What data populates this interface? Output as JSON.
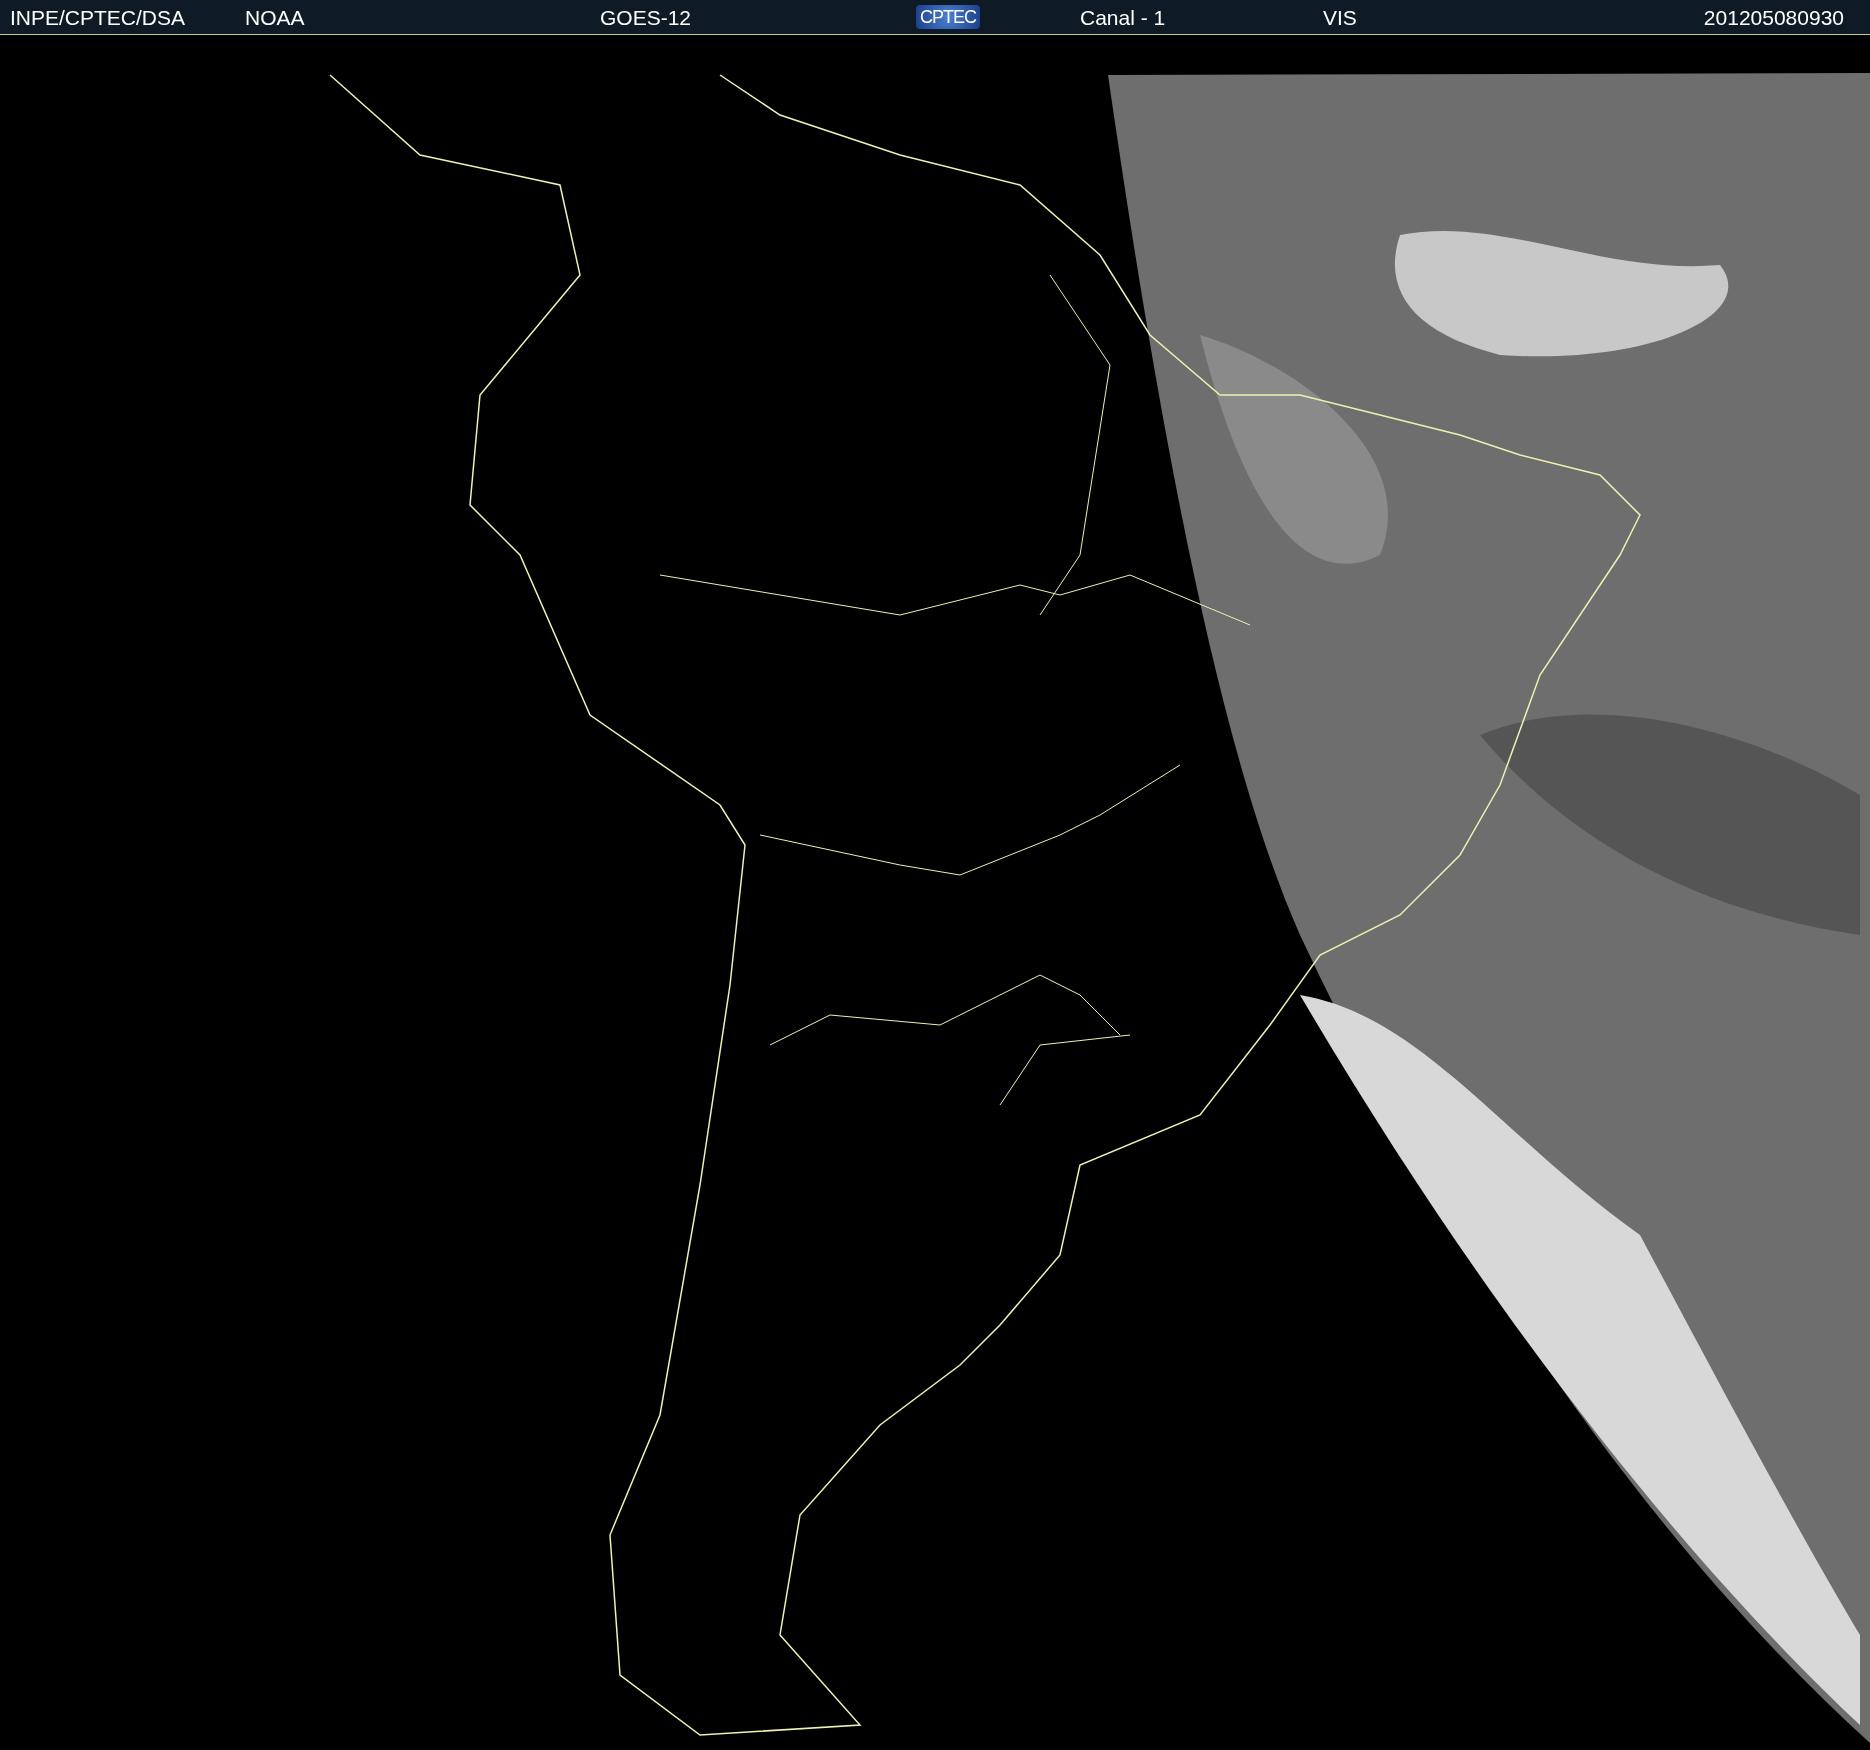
{
  "header": {
    "source": "INPE/CPTEC/DSA",
    "agency": "NOAA",
    "satellite": "GOES-12",
    "logo": "CPTEC",
    "channel": "Canal - 1",
    "band": "VIS",
    "timestamp": "201205080930"
  }
}
